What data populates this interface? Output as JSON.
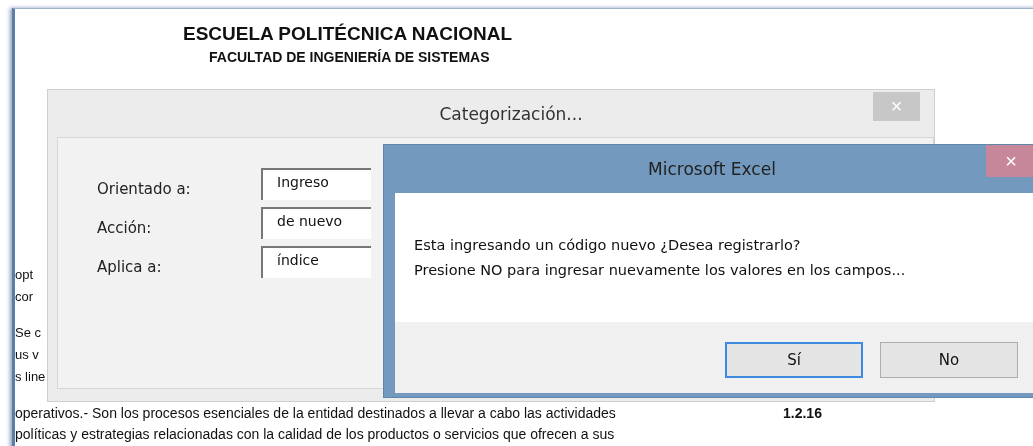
{
  "document": {
    "title": "ESCUELA POLITÉCNICA NACIONAL",
    "subtitle": "FACULTAD DE INGENIERÍA DE SISTEMAS",
    "fragment_groups": [
      [
        "opt",
        "cor"
      ],
      [
        "Se c",
        "us v",
        "s line"
      ]
    ],
    "lines": [
      "operativos.- Son los procesos esenciales de la entidad destinados a llevar a cabo las actividades",
      "políticas y estrategias relacionadas con la calidad de los productos o servicios que ofrecen a sus"
    ],
    "number": "1.2.16"
  },
  "categorization_dialog": {
    "title": "Categorización...",
    "close": "×",
    "fields": [
      {
        "label": "Orientado a:",
        "value": "Ingreso"
      },
      {
        "label": "Acción:",
        "value": "de nuevo"
      },
      {
        "label": "Aplica a:",
        "value": "índice"
      }
    ]
  },
  "message_box": {
    "title": "Microsoft Excel",
    "close": "×",
    "message": [
      "Esta ingresando un código nuevo ¿Desea registrarlo?",
      "Presione NO para ingresar nuevamente los valores en los campos..."
    ],
    "buttons": [
      {
        "label": "Sí",
        "selected": true
      },
      {
        "label": "No",
        "selected": false
      }
    ]
  }
}
